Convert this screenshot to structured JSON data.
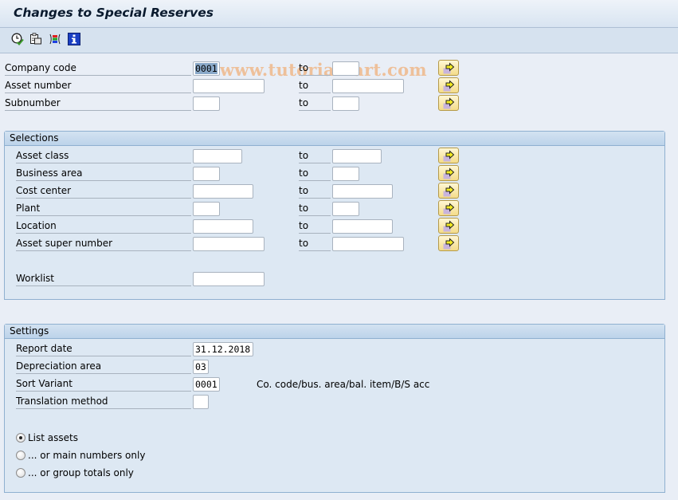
{
  "window": {
    "title": "Changes to Special Reserves",
    "watermark": "© www.tutorialkart.com"
  },
  "toolbar": {
    "icons": [
      {
        "name": "execute-icon",
        "tooltip": "Execute"
      },
      {
        "name": "get-variant-icon",
        "tooltip": "Get Variant"
      },
      {
        "name": "dynamic-selections-icon",
        "tooltip": "Dynamic Selections"
      },
      {
        "name": "info-icon",
        "tooltip": "Information"
      }
    ]
  },
  "header_fields": {
    "to_label": "to",
    "rows": [
      {
        "label": "Company code",
        "from": "0001",
        "to": ""
      },
      {
        "label": "Asset number",
        "from": "",
        "to": ""
      },
      {
        "label": "Subnumber",
        "from": "",
        "to": ""
      }
    ]
  },
  "selections": {
    "title": "Selections",
    "to_label": "to",
    "rows": [
      {
        "label": "Asset class",
        "from": "",
        "to": ""
      },
      {
        "label": "Business area",
        "from": "",
        "to": ""
      },
      {
        "label": "Cost center",
        "from": "",
        "to": ""
      },
      {
        "label": "Plant",
        "from": "",
        "to": ""
      },
      {
        "label": "Location",
        "from": "",
        "to": ""
      },
      {
        "label": "Asset super number",
        "from": "",
        "to": ""
      }
    ],
    "worklist": {
      "label": "Worklist",
      "value": ""
    }
  },
  "settings": {
    "title": "Settings",
    "fields": [
      {
        "label": "Report date",
        "value": "31.12.2018"
      },
      {
        "label": "Depreciation area",
        "value": "03"
      },
      {
        "label": "Sort Variant",
        "value": "0001",
        "description": "Co. code/bus. area/bal. item/B/S acc"
      },
      {
        "label": "Translation method",
        "value": ""
      }
    ],
    "radios": [
      {
        "label": "List assets",
        "selected": true
      },
      {
        "label": "... or main numbers only",
        "selected": false
      },
      {
        "label": "... or group totals only",
        "selected": false
      }
    ]
  }
}
